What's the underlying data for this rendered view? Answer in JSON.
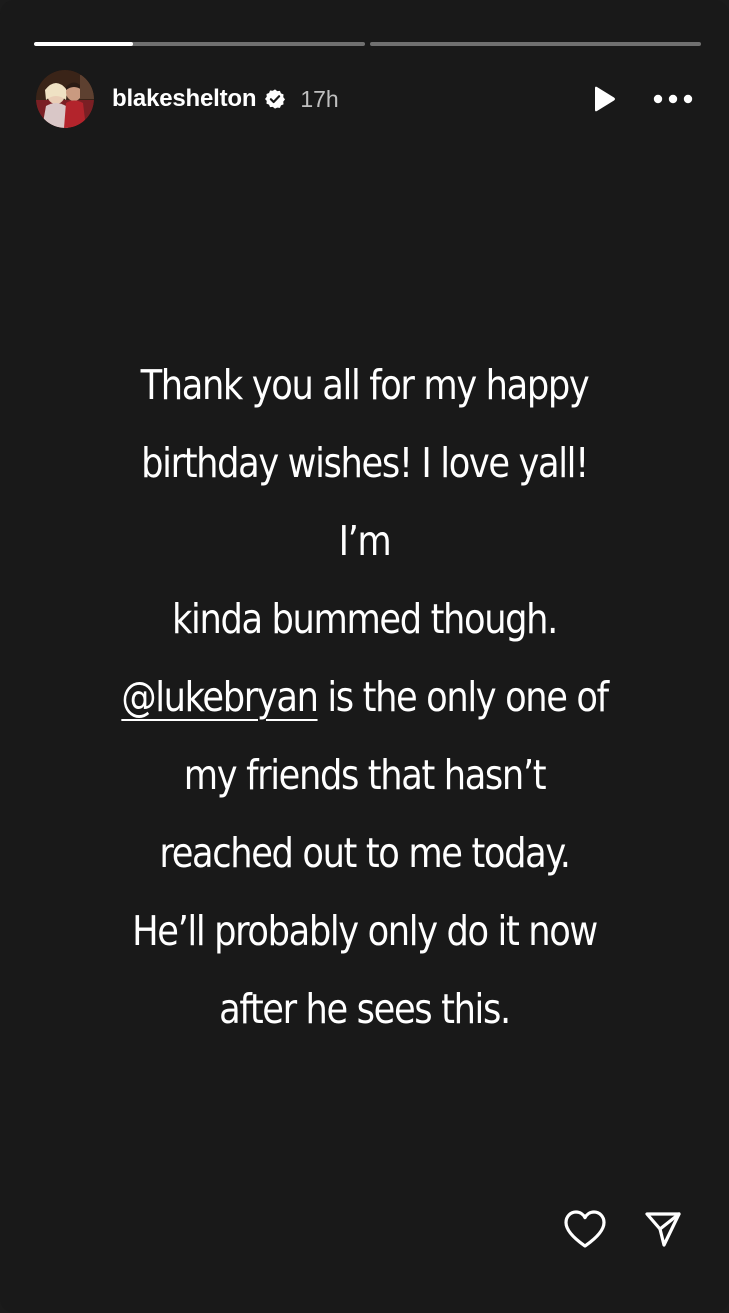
{
  "progress": [
    {
      "fill": 0.3
    },
    {
      "fill": 0.0
    }
  ],
  "header": {
    "username": "blakeshelton",
    "verified_icon": "verified-badge-icon",
    "timestamp": "17h",
    "play_icon": "play-icon",
    "more_icon": "more-options-icon"
  },
  "story": {
    "line1": "Thank you all for my happy",
    "line2": "birthday wishes! I love yall! I’m",
    "line3": "kinda bummed though.",
    "mention": "@lukebryan",
    "line4_rest": " is the only one of",
    "line5": "my friends that hasn’t",
    "line6": "reached out to me today.",
    "line7": "He’ll probably only do it now",
    "line8": "after he sees this."
  },
  "footer": {
    "like_icon": "heart-icon",
    "share_icon": "send-icon"
  },
  "colors": {
    "background": "#191919",
    "text": "#ffffff"
  }
}
